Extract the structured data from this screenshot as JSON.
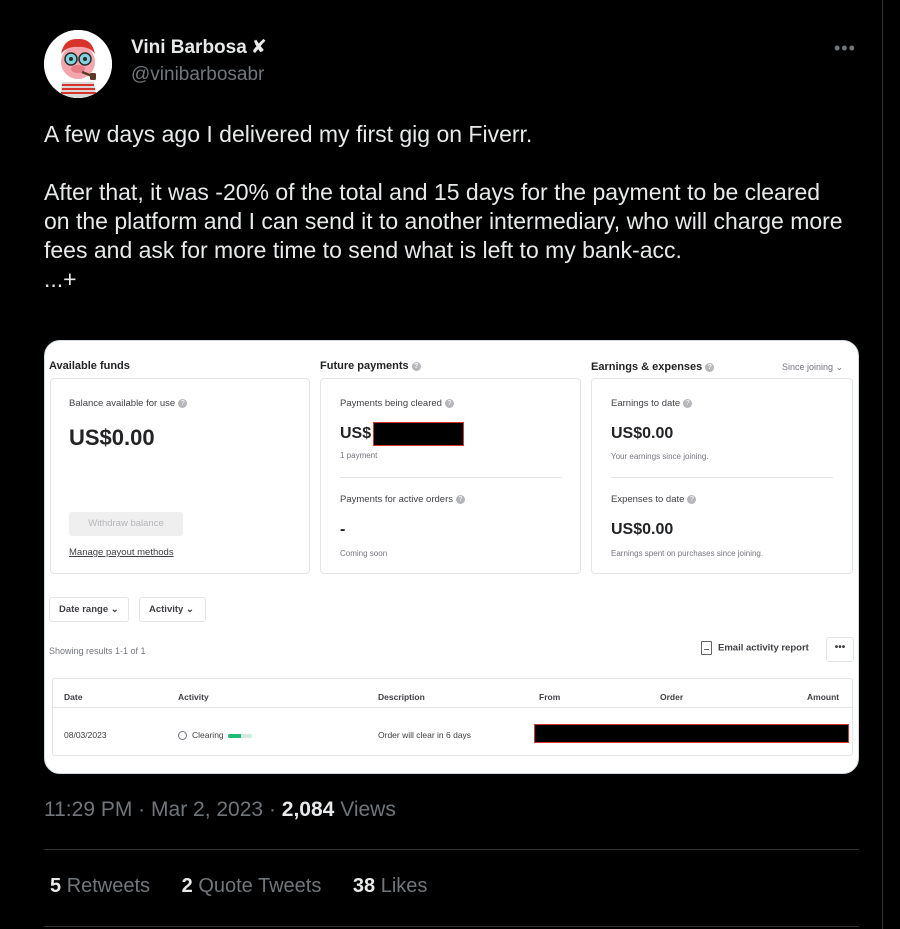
{
  "tweet": {
    "author_name": "Vini Barbosa",
    "badge": "✘",
    "handle": "@vinibarbosabr",
    "more_label": "•••",
    "text": "A few days ago I delivered my first gig on Fiverr.\n\nAfter that, it was -20% of the total and 15 days for the payment to be cleared on the platform and I can send it to another intermediary, who will charge more fees and ask for more time to send what is left to my bank-acc.\n...+",
    "time": "11:29 PM",
    "dot1": "·",
    "date": "Mar 2, 2023",
    "dot2": "·",
    "views_count": "2,084",
    "views_label": "Views"
  },
  "stats": {
    "retweets_count": "5",
    "retweets_label": "Retweets",
    "quotes_count": "2",
    "quotes_label": "Quote Tweets",
    "likes_count": "38",
    "likes_label": "Likes"
  },
  "card": {
    "available": {
      "title": "Available funds",
      "balance_label": "Balance available for use",
      "balance_value": "US$0.00",
      "withdraw_label": "Withdraw balance",
      "manage_label": "Manage payout methods"
    },
    "future": {
      "title": "Future payments",
      "clearing_label": "Payments being cleared",
      "clearing_value": "US$",
      "clearing_sub": "1 payment",
      "active_label": "Payments for active orders",
      "active_value": "-",
      "active_sub": "Coming soon"
    },
    "earnings": {
      "title": "Earnings & expenses",
      "since": "Since joining",
      "earn_label": "Earnings to date",
      "earn_value": "US$0.00",
      "earn_sub": "Your earnings since joining.",
      "exp_label": "Expenses to date",
      "exp_value": "US$0.00",
      "exp_sub": "Earnings spent on purchases since joining."
    },
    "filters": {
      "date_range": "Date range",
      "activity": "Activity"
    },
    "results_text": "Showing results 1-1 of 1",
    "email_report": "Email activity report",
    "more": "•••",
    "table": {
      "headers": [
        "Date",
        "Activity",
        "Description",
        "From",
        "Order",
        "Amount"
      ],
      "row": {
        "date": "08/03/2023",
        "activity": "Clearing",
        "description": "Order will clear in 6 days"
      },
      "progress": 0.55
    }
  }
}
